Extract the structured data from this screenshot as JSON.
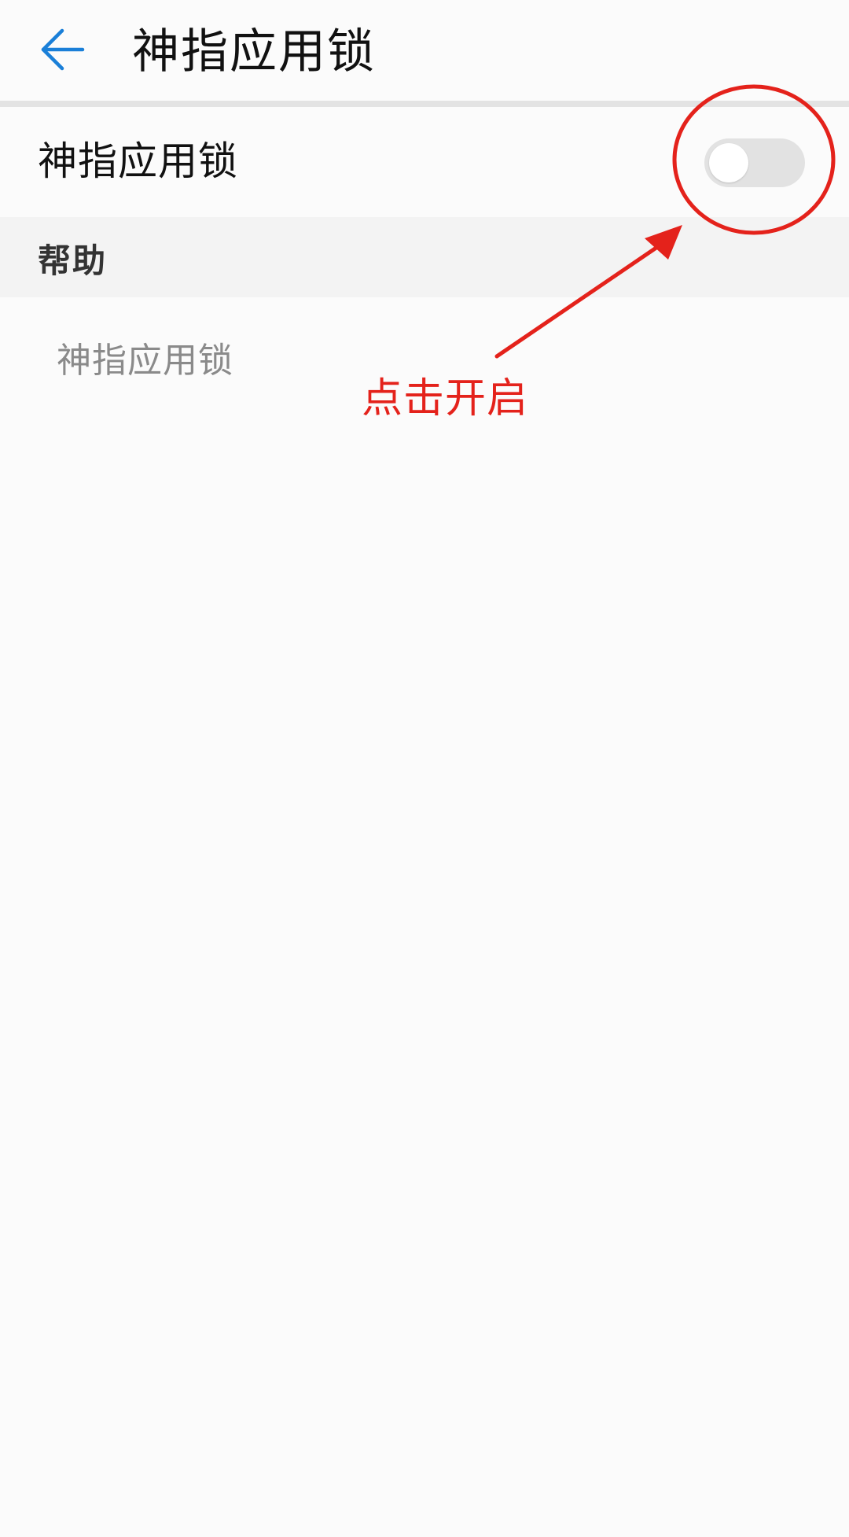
{
  "app_bar": {
    "title": "神指应用锁",
    "back_icon": "arrow-left-icon",
    "accent_color": "#1a7fd8"
  },
  "setting": {
    "label": "神指应用锁",
    "toggle_state": "off"
  },
  "help": {
    "section_title": "帮助",
    "items": [
      {
        "label": "神指应用锁"
      }
    ]
  },
  "annotation": {
    "text": "点击开启",
    "color": "#e4221b"
  }
}
